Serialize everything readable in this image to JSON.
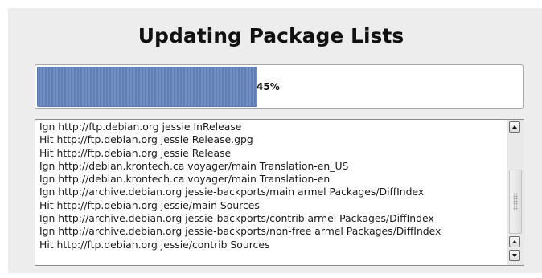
{
  "dialog": {
    "title": "Updating Package Lists"
  },
  "progress": {
    "value": 0.45,
    "label": "45%",
    "fill_color": "#6786bd"
  },
  "log": {
    "lines": [
      "Ign http://ftp.debian.org jessie InRelease",
      "Hit http://ftp.debian.org jessie Release.gpg",
      "Hit http://ftp.debian.org jessie Release",
      "Ign http://debian.krontech.ca voyager/main Translation-en_US",
      "Ign http://debian.krontech.ca voyager/main Translation-en",
      "Ign http://archive.debian.org jessie-backports/main armel Packages/DiffIndex",
      "Hit http://ftp.debian.org jessie/main Sources",
      "Ign http://archive.debian.org jessie-backports/contrib armel Packages/DiffIndex",
      "Ign http://archive.debian.org jessie-backports/non-free armel Packages/DiffIndex",
      "Hit http://ftp.debian.org jessie/contrib Sources"
    ]
  },
  "icons": {
    "scroll_up": "arrow-up-icon",
    "scroll_down": "arrow-down-icon"
  }
}
